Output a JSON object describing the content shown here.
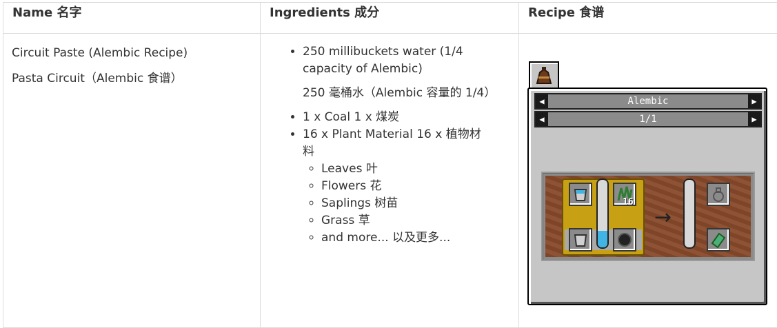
{
  "headers": {
    "name": "Name  名字",
    "ingredients": "Ingredients  成分",
    "recipe": "Recipe  食谱"
  },
  "name_cell": {
    "english": "Circuit Paste (Alembic Recipe)",
    "chinese": "Pasta Circuit（Alembic 食谱）"
  },
  "ingredients": {
    "water": "250 millibuckets water (1/4 capacity of Alembic)",
    "water_translation": "250 毫桶水（Alembic 容量的 1/4）",
    "coal": "1 x Coal  1 x 煤炭",
    "plant": "16 x Plant Material   16 x 植物材料",
    "plant_sub": [
      "Leaves  叶",
      "Flowers  花",
      "Saplings  树苗",
      "Grass  草",
      "and more...  以及更多..."
    ]
  },
  "gui": {
    "machine_name": "Alembic",
    "page": "1/1",
    "arrow_left": "◀",
    "arrow_right": "▶",
    "plant_count": "16",
    "water_fill": 0.25,
    "colors": {
      "panel": "#c6c6c6",
      "bar": "#8b8b8b",
      "recipe_bg": "#8a4b2c",
      "yellow": "#c8a014",
      "water": "#3fb4e5"
    },
    "icons": [
      "alembic-tab-icon",
      "water-bucket-icon",
      "empty-bucket-icon",
      "leaves-icon",
      "coal-icon",
      "empty-bottle-icon",
      "circuit-paste-icon"
    ]
  }
}
